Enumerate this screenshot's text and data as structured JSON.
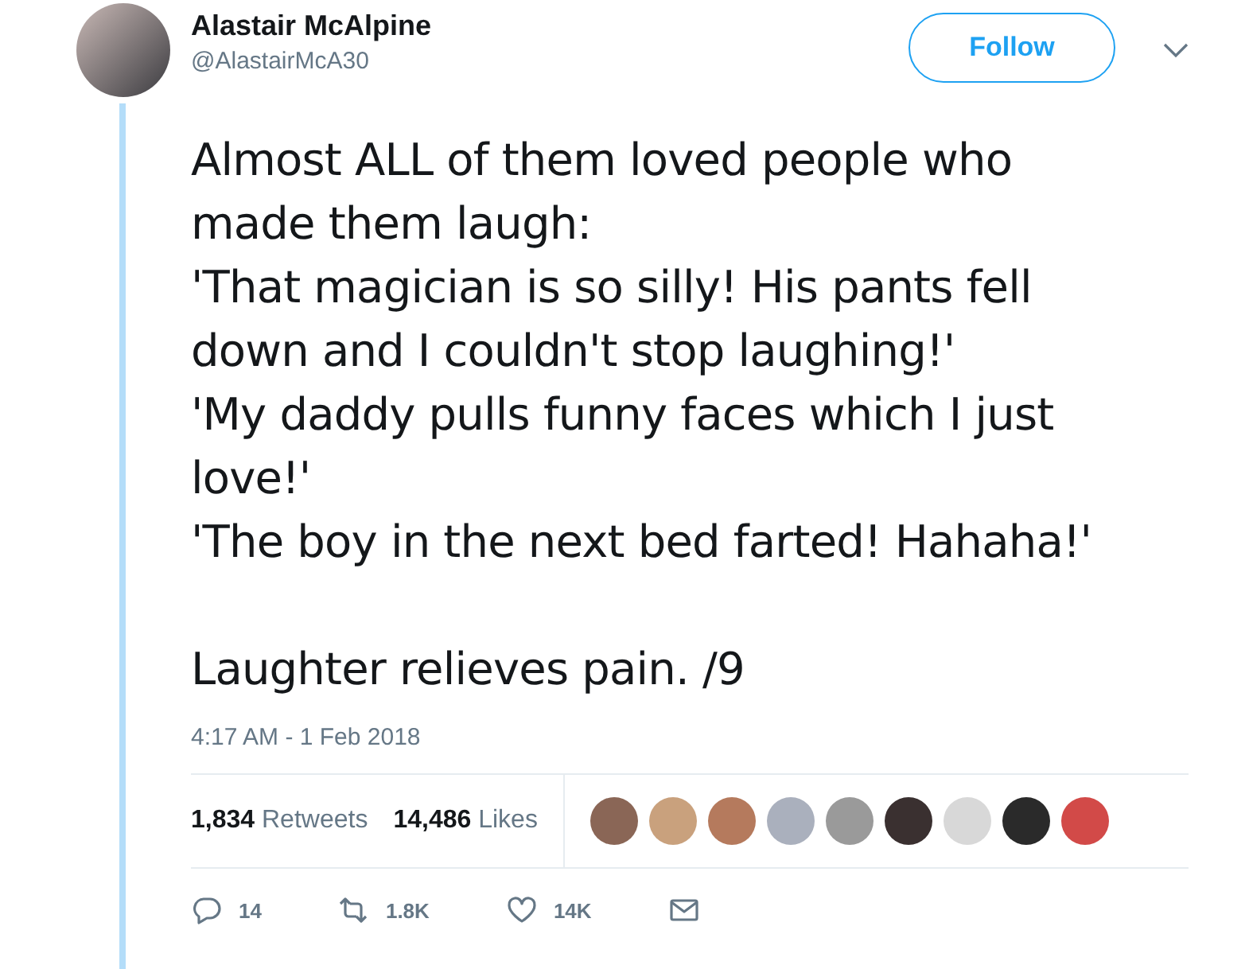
{
  "author": {
    "name": "Alastair McAlpine",
    "handle": "@AlastairMcA30"
  },
  "follow_button": {
    "label": "Follow"
  },
  "body": [
    [
      "Almost ALL of them loved people who",
      "made them laugh:",
      "'That magician is so silly! His pants fell",
      "down and I couldn't stop laughing!'",
      "'My daddy pulls funny faces which I just",
      "love!'",
      "'The boy in the next bed farted! Hahaha!'"
    ],
    [
      "Laughter relieves pain. /9"
    ]
  ],
  "timestamp": "4:17 AM - 1 Feb 2018",
  "stats": [
    {
      "count": "1,834",
      "label": "Retweets"
    },
    {
      "count": "14,486",
      "label": "Likes"
    }
  ],
  "actions": [
    {
      "kind": "reply",
      "count": "14"
    },
    {
      "kind": "retweet",
      "count": "1.8K"
    },
    {
      "kind": "like",
      "count": "14K"
    },
    {
      "kind": "message"
    }
  ]
}
